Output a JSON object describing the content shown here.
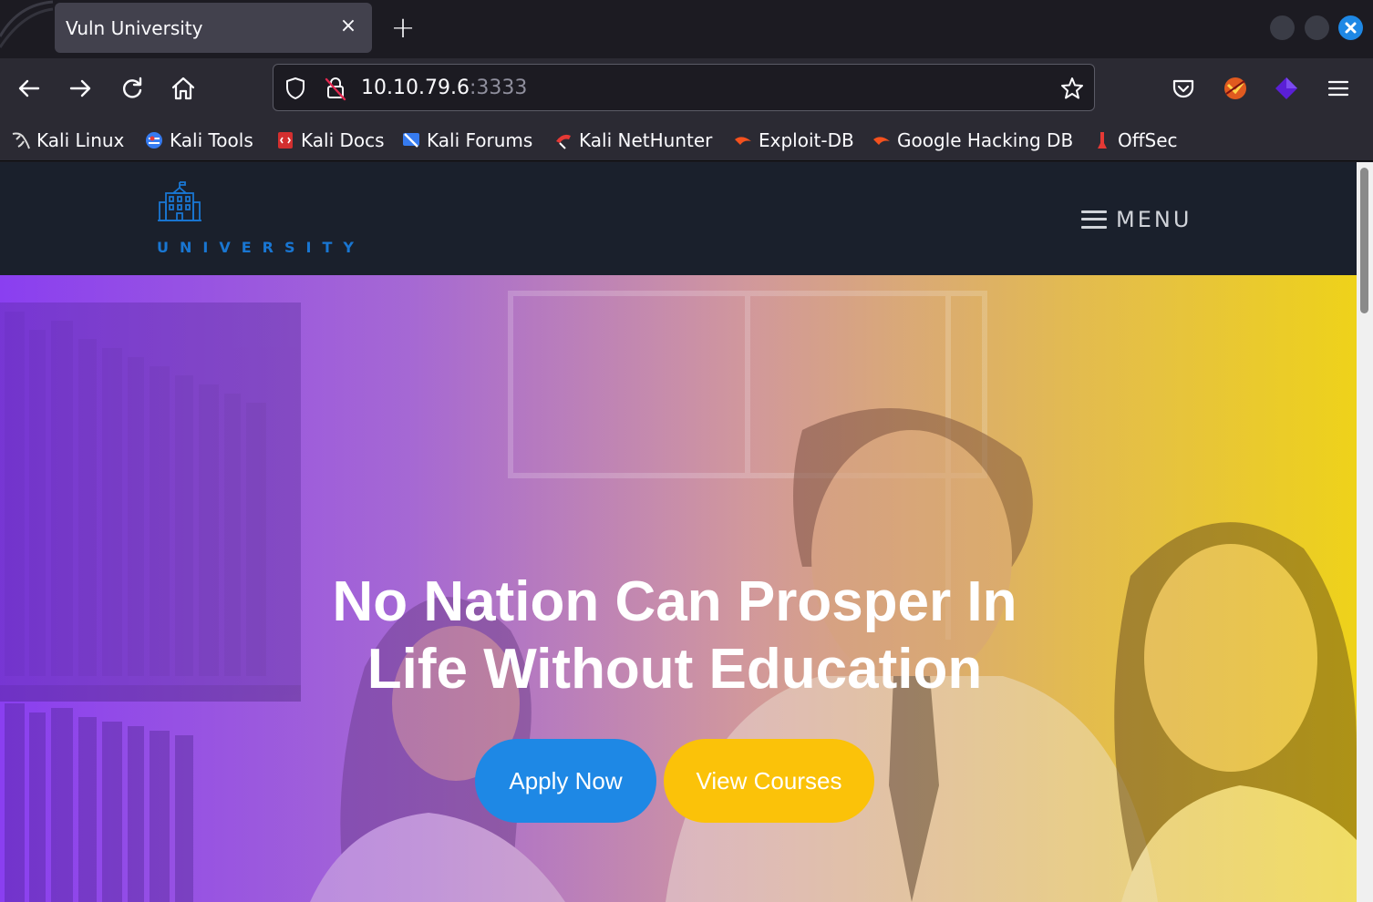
{
  "browser": {
    "tab": {
      "title": "Vuln University",
      "close_label": "×"
    },
    "new_tab_label": "+",
    "url": {
      "host": "10.10.79.6",
      "port": ":3333"
    },
    "bookmarks": [
      {
        "label": "Kali Linux",
        "icon": "kali-dragon-icon"
      },
      {
        "label": "Kali Tools",
        "icon": "kali-tools-icon"
      },
      {
        "label": "Kali Docs",
        "icon": "kali-docs-icon"
      },
      {
        "label": "Kali Forums",
        "icon": "kali-forums-icon"
      },
      {
        "label": "Kali NetHunter",
        "icon": "kali-nethunter-icon"
      },
      {
        "label": "Exploit-DB",
        "icon": "exploit-db-icon"
      },
      {
        "label": "Google Hacking DB",
        "icon": "ghdb-icon"
      },
      {
        "label": "OffSec",
        "icon": "offsec-icon"
      }
    ]
  },
  "site": {
    "logo_text": "UNIVERSITY",
    "menu_label": "MENU",
    "hero": {
      "title_line1": "No Nation Can Prosper In",
      "title_line2": "Life Without Education",
      "apply_label": "Apply Now",
      "courses_label": "View Courses"
    }
  },
  "colors": {
    "accent_blue": "#1e88e5",
    "accent_yellow": "#fbc209",
    "header_bg": "#1a202c",
    "logo_blue": "#1976d2"
  }
}
